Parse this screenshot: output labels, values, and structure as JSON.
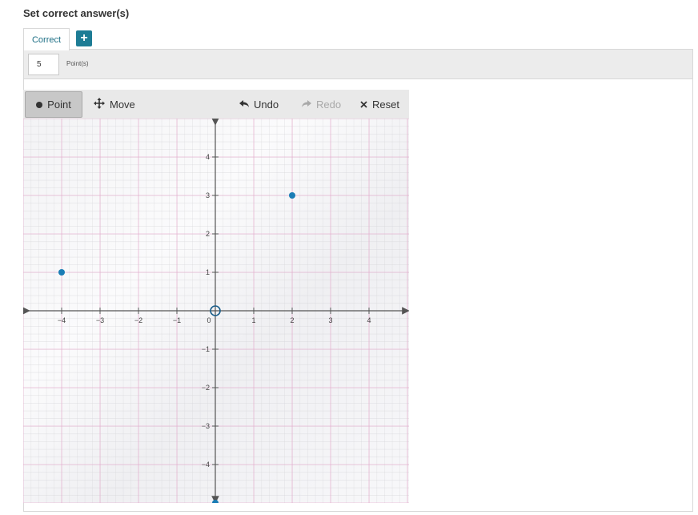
{
  "page": {
    "heading": "Set correct answer(s)"
  },
  "tabs": {
    "correct_label": "Correct",
    "add_label": "+"
  },
  "points": {
    "value": "5",
    "label": "Point(s)"
  },
  "toolbar": {
    "point_label": "Point",
    "move_label": "Move",
    "undo_label": "Undo",
    "redo_label": "Redo",
    "reset_label": "Reset"
  },
  "graph": {
    "x_range": [
      -5,
      5
    ],
    "y_range": [
      -5,
      5
    ],
    "x_ticks": [
      "−4",
      "−3",
      "−2",
      "−1",
      "0",
      "1",
      "2",
      "3",
      "4"
    ],
    "y_ticks": [
      "4",
      "3",
      "2",
      "1",
      "−1",
      "−2",
      "−3",
      "−4"
    ],
    "origin_marker": "open-circle",
    "points": [
      {
        "x": -4,
        "y": 1
      },
      {
        "x": 2,
        "y": 3
      }
    ],
    "colors": {
      "point": "#1a7db5",
      "origin": "#1a5e8a",
      "accent": "#1d7c95",
      "grid_major": "#e6aacc"
    }
  }
}
